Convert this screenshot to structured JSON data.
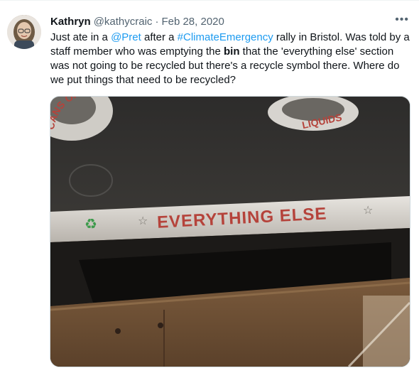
{
  "tweet": {
    "author_name": "Kathryn",
    "author_handle": "@kathycraic",
    "separator": "·",
    "date": "Feb 28, 2020",
    "more_icon": "more-horizontal-icon",
    "text": {
      "part1": "Just ate in a ",
      "mention": "@Pret",
      "part2": " after a ",
      "hashtag": "#ClimateEmergency",
      "part3": " rally in Bristol.  Was told by a staff member who was emptying the ",
      "bold": "bin",
      "part4": " that the 'everything else' section was not going to be recycled but there's a recycle symbol there. Where do we put things that need to be recycled?"
    },
    "media": {
      "sign_main": "EVERYTHING ELSE",
      "sign_cans": "CANS ONLY",
      "sign_liquids": "LIQUIDS",
      "recycle_icon": "recycle-icon",
      "star_icon": "star-icon"
    },
    "colors": {
      "link": "#1d9bf0",
      "text": "#0f1419",
      "muted": "#536471",
      "sign_red": "#b5433b"
    }
  }
}
